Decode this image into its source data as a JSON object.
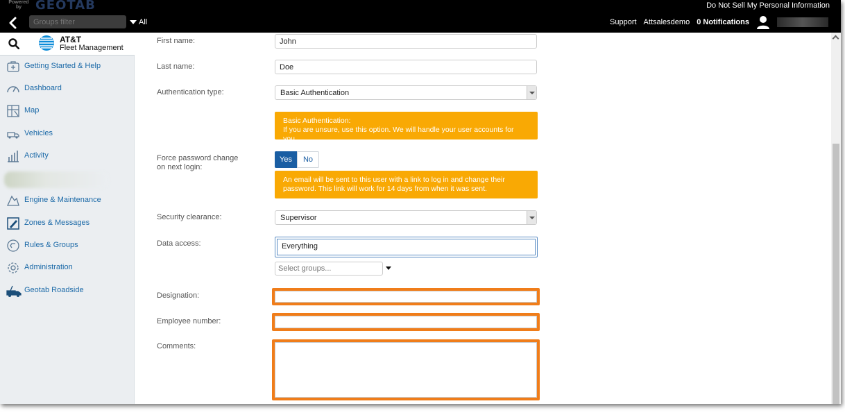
{
  "topbar": {
    "powered_by": "Powered by",
    "brand_logo": "GEOTAB",
    "do_not_sell": "Do Not Sell My Personal Information",
    "groups_filter_placeholder": "Groups filter",
    "all_label": "All",
    "support": "Support",
    "account": "Attsalesdemo",
    "notifications": "0 Notifications"
  },
  "sidebar": {
    "brand_line1": "AT&T",
    "brand_line2": "Fleet Management",
    "items": [
      {
        "label": "Getting Started & Help",
        "icon": "help-kit-icon"
      },
      {
        "label": "Dashboard",
        "icon": "gauge-icon"
      },
      {
        "label": "Map",
        "icon": "map-icon"
      },
      {
        "label": "Vehicles",
        "icon": "truck-icon"
      },
      {
        "label": "Activity",
        "icon": "bar-chart-icon"
      },
      {
        "label": "Engine & Maintenance",
        "icon": "engine-icon"
      },
      {
        "label": "Zones & Messages",
        "icon": "zone-edit-icon"
      },
      {
        "label": "Rules & Groups",
        "icon": "rules-icon"
      },
      {
        "label": "Administration",
        "icon": "gear-icon"
      },
      {
        "label": "Geotab Roadside",
        "icon": "roadside-truck-icon"
      }
    ],
    "colors": {
      "link": "#1c6aa8"
    }
  },
  "form": {
    "first_name_label": "First name:",
    "first_name_value": "John",
    "last_name_label": "Last name:",
    "last_name_value": "Doe",
    "auth_type_label": "Authentication type:",
    "auth_type_value": "Basic Authentication",
    "auth_notice_title": "Basic Authentication:",
    "auth_notice_text": "If you are unsure, use this option. We will handle your user accounts for you.",
    "force_pw_label": "Force password change on next login:",
    "force_pw_yes": "Yes",
    "force_pw_no": "No",
    "force_pw_notice": "An email will be sent to this user with a link to log in and change their password. This link will work for 14 days from when it was sent.",
    "security_label": "Security clearance:",
    "security_value": "Supervisor",
    "data_access_label": "Data access:",
    "data_access_value": "Everything",
    "select_groups_placeholder": "Select groups...",
    "designation_label": "Designation:",
    "employee_number_label": "Employee number:",
    "comments_label": "Comments:",
    "colors": {
      "notice": "#f9a904",
      "highlight": "#f07d1a",
      "toggle_active": "#1a5ea3"
    }
  }
}
